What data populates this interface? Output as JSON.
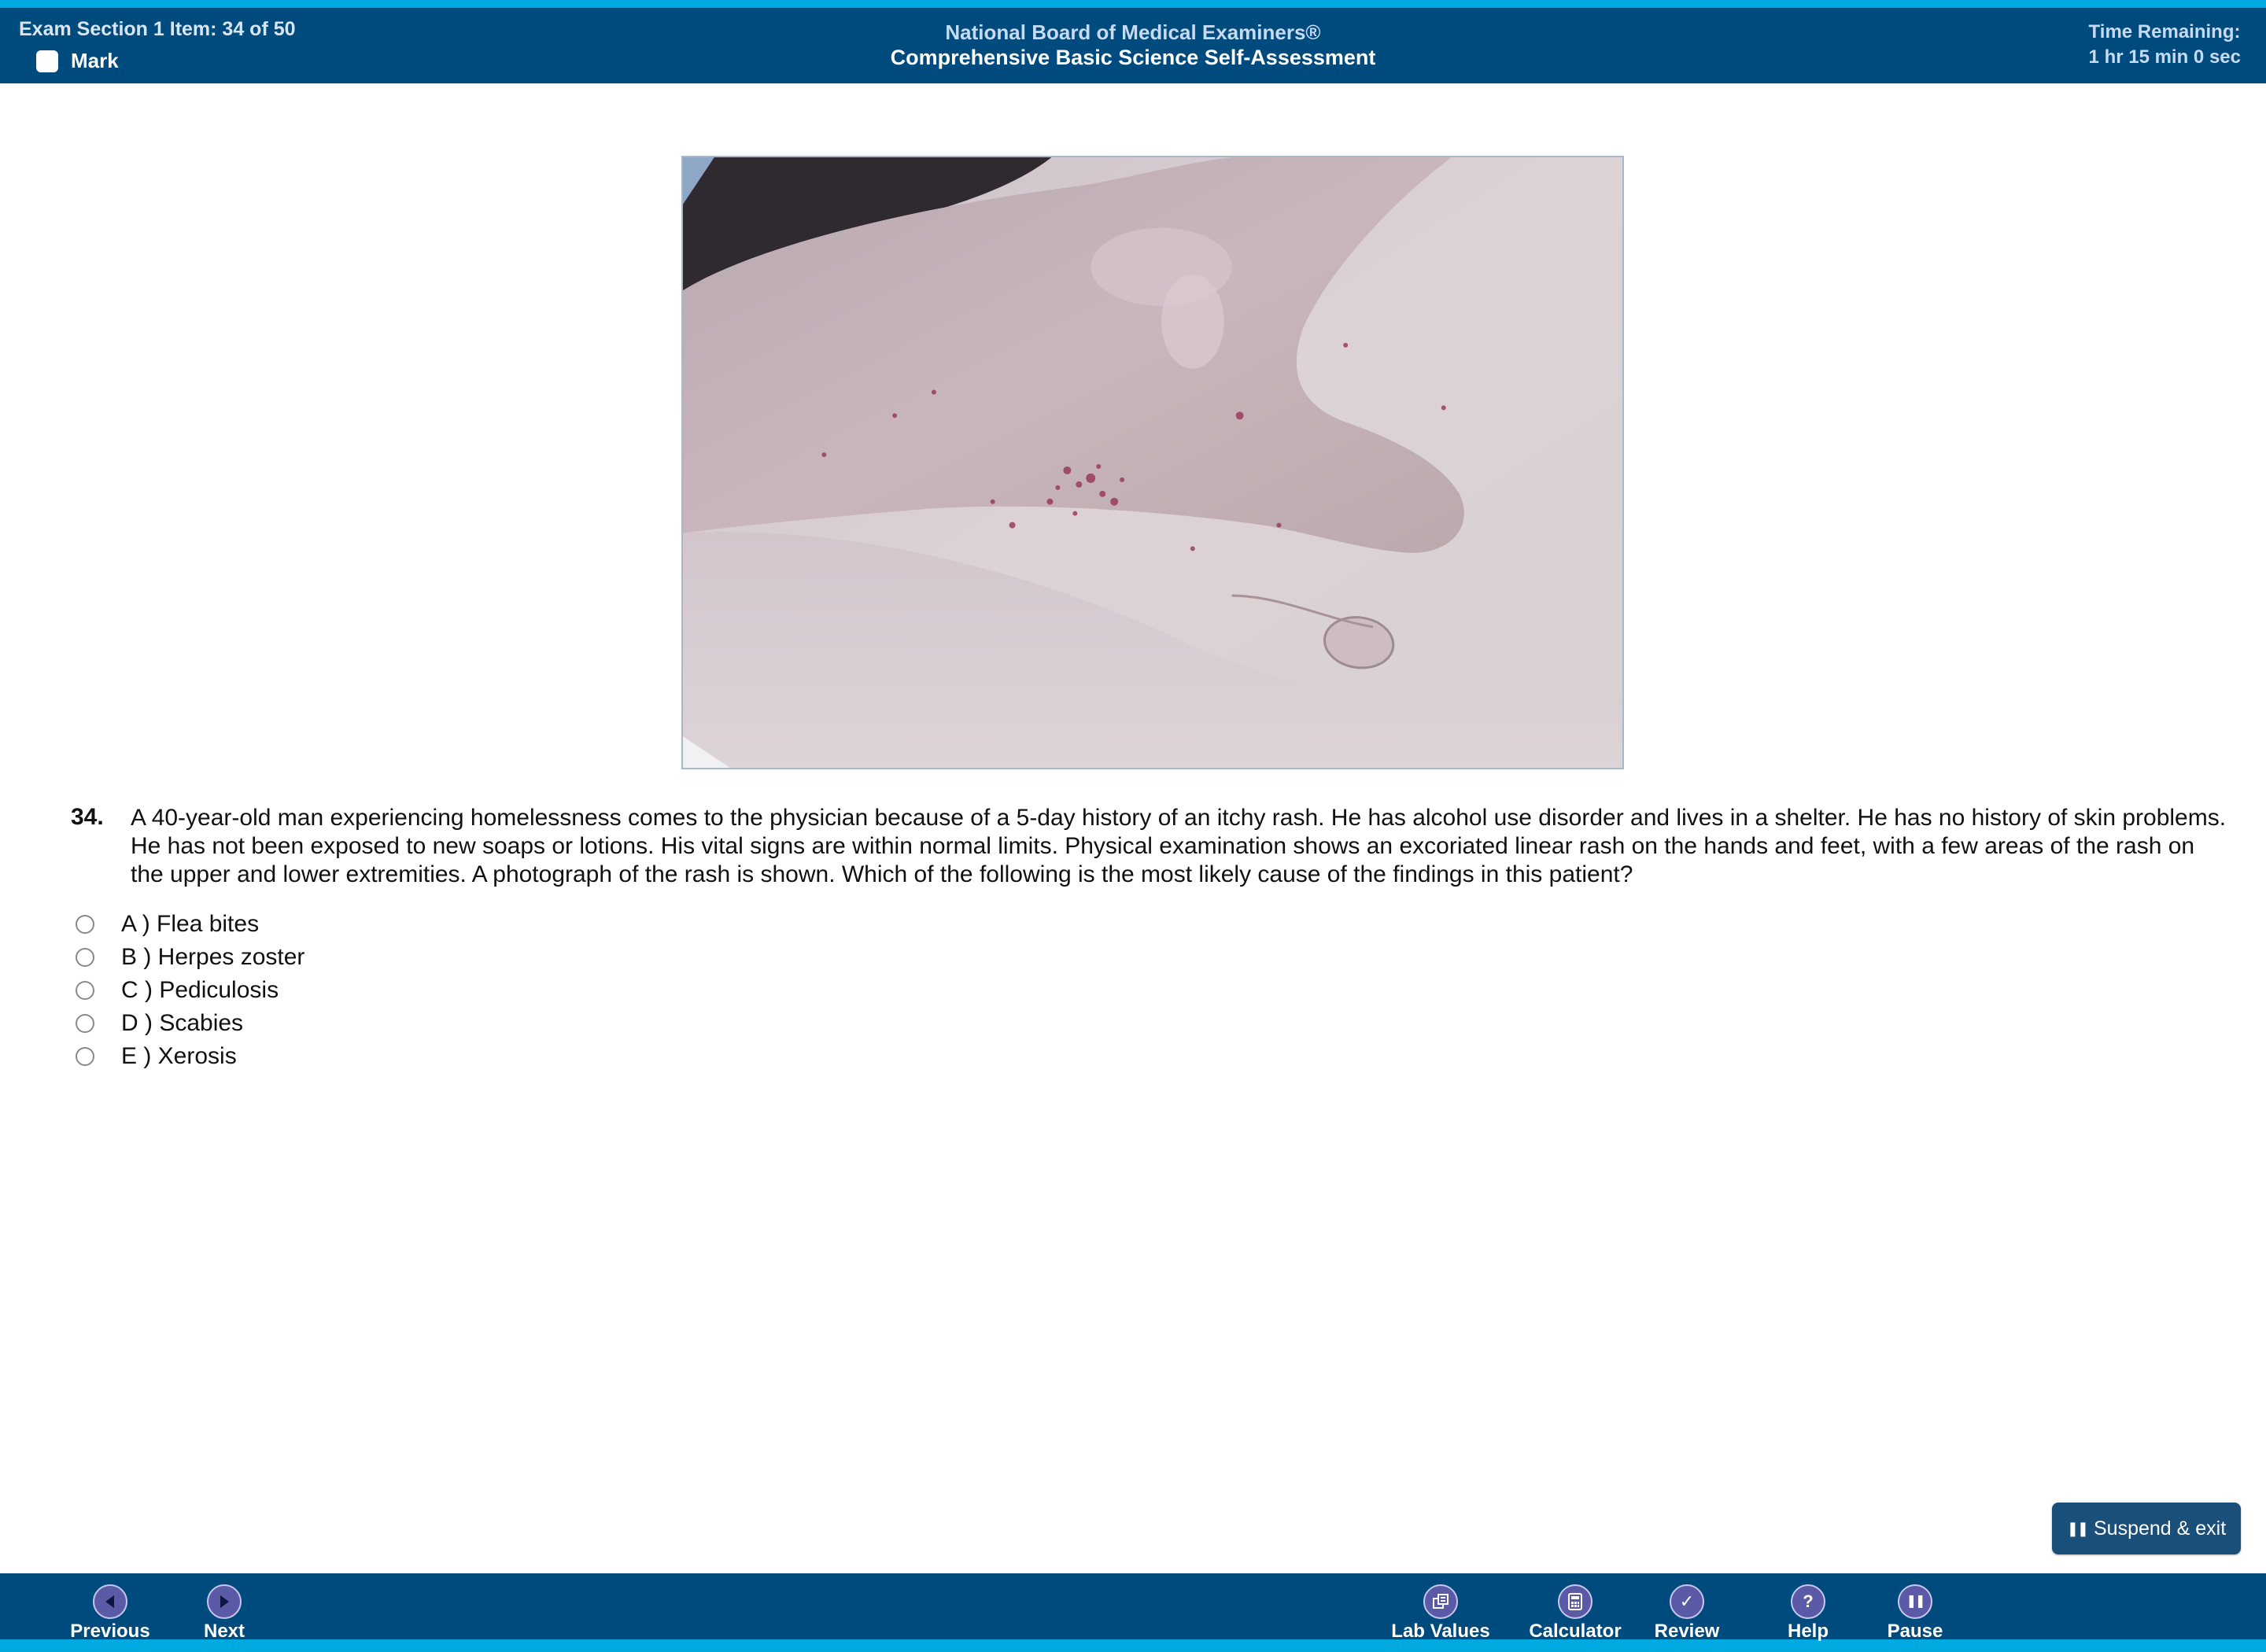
{
  "header": {
    "item_info": "Exam Section 1 Item: 34 of 50",
    "mark_label": "Mark",
    "board_name": "National Board of Medical Examiners®",
    "exam_name": "Comprehensive Basic Science Self-Assessment",
    "time_label": "Time Remaining:",
    "time_value": "1 hr 15 min 0 sec"
  },
  "question": {
    "number": "34.",
    "stem": "A 40-year-old man experiencing homelessness comes to the physician because of a 5-day history of an itchy rash. He has alcohol use disorder and lives in a shelter. He has no history of skin problems. He has not been exposed to new soaps or lotions. His vital signs are within normal limits. Physical examination shows an excoriated linear rash on the hands and feet, with a few areas of the rash on the upper and lower extremities. A photograph of the rash is shown. Which of the following is the most likely cause of the findings in this patient?",
    "options": [
      {
        "label": "A ) Flea bites"
      },
      {
        "label": "B ) Herpes zoster"
      },
      {
        "label": "C ) Pediculosis"
      },
      {
        "label": "D ) Scabies"
      },
      {
        "label": "E ) Xerosis"
      }
    ]
  },
  "suspend": {
    "label": "Suspend & exit",
    "icon": "pause-icon"
  },
  "footer": {
    "previous": {
      "label": "Previous",
      "icon": "arrow-left-icon"
    },
    "next": {
      "label": "Next",
      "icon": "arrow-right-icon"
    },
    "lab_values": {
      "label": "Lab Values",
      "icon": "lab-values-icon"
    },
    "calculator": {
      "label": "Calculator",
      "icon": "calculator-icon"
    },
    "review": {
      "label": "Review",
      "icon": "checkmark-icon"
    },
    "help": {
      "label": "Help",
      "icon": "question-icon"
    },
    "pause": {
      "label": "Pause",
      "icon": "pause-icon"
    }
  },
  "colors": {
    "header_bg": "#004b7d",
    "accent_strip": "#00a9e0",
    "nav_button": "#5a5aa6",
    "suspend_button": "#1a4f7a"
  }
}
